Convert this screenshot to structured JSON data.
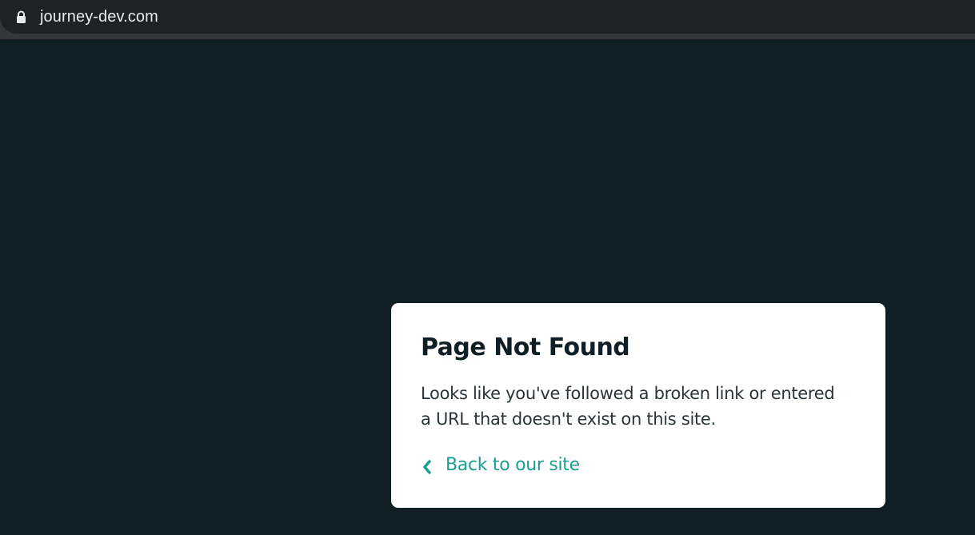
{
  "browser": {
    "url": "journey-dev.com",
    "lock_icon": "lock-icon"
  },
  "error_card": {
    "title": "Page Not Found",
    "message_line1": "Looks like you've followed a broken link or entered",
    "message_line2": "a URL that doesn't exist on this site.",
    "back_link_label": "Back to our site",
    "back_icon": "chevron-left-icon"
  },
  "colors": {
    "page_background": "#0f1f25",
    "card_background": "#ffffff",
    "accent": "#1a9e8f",
    "title_text": "#0f1f25"
  }
}
